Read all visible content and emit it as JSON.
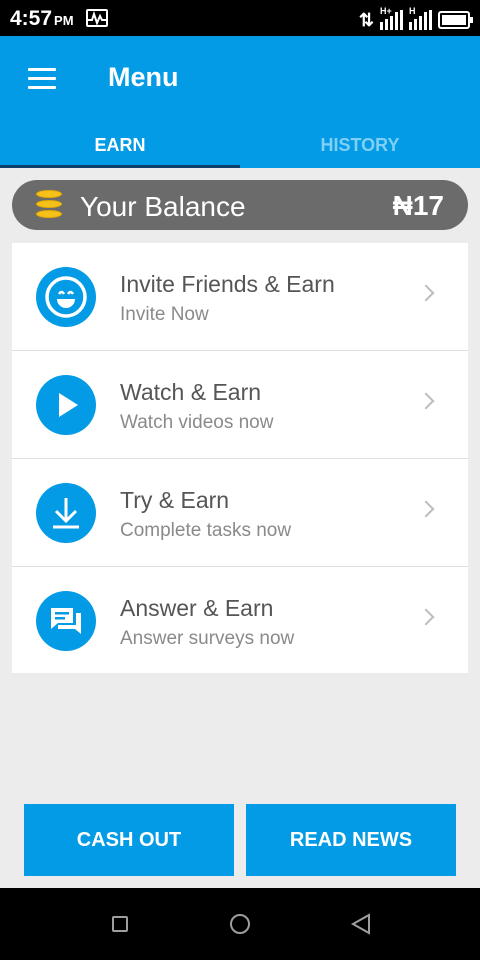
{
  "status_bar": {
    "time": "4:57",
    "ampm": "PM",
    "network_label": "H+",
    "network_label_2": "H",
    "icons": [
      "activity-icon",
      "data-arrows-icon",
      "signal-icon",
      "signal-icon",
      "battery-icon"
    ]
  },
  "app_bar": {
    "title": "Menu",
    "menu_icon": "hamburger-icon"
  },
  "tabs": [
    {
      "label": "EARN",
      "active": true
    },
    {
      "label": "HISTORY",
      "active": false
    }
  ],
  "balance": {
    "label": "Your Balance",
    "value": "₦17",
    "icon": "coins-icon"
  },
  "earn_items": [
    {
      "title": "Invite Friends & Earn",
      "subtitle": "Invite Now",
      "icon": "smiley-icon"
    },
    {
      "title": "Watch & Earn",
      "subtitle": "Watch videos now",
      "icon": "play-icon"
    },
    {
      "title": "Try & Earn",
      "subtitle": "Complete tasks now",
      "icon": "download-icon"
    },
    {
      "title": "Answer & Earn",
      "subtitle": "Answer surveys now",
      "icon": "chat-icon"
    }
  ],
  "buttons": {
    "cash_out": "CASH OUT",
    "read_news": "READ NEWS"
  },
  "colors": {
    "accent": "#039be5",
    "balance_bg": "#6b6b6b",
    "coin": "#f6c21a"
  }
}
